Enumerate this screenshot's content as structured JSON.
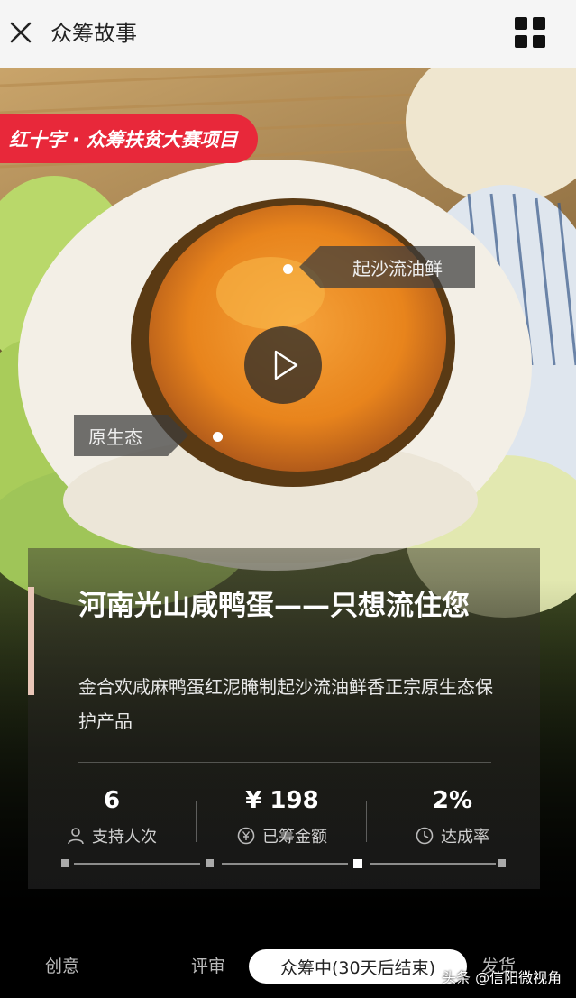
{
  "header": {
    "title": "众筹故事",
    "close_icon": "close-icon",
    "menu_icon": "grid-icon"
  },
  "hero": {
    "badge": "红十字 · 众筹扶贫大赛项目",
    "tag_right": "起沙流油鲜",
    "tag_left": "原生态",
    "play_icon": "play-icon"
  },
  "card": {
    "title": "河南光山咸鸭蛋——只想流住您",
    "description": "金合欢咸麻鸭蛋红泥腌制起沙流油鲜香正宗原生态保护产品",
    "stats": [
      {
        "value": "6",
        "label": "支持人次",
        "icon": "person-icon"
      },
      {
        "value": "¥ 198",
        "label": "已筹金额",
        "icon": "yen-coin-icon"
      },
      {
        "value": "2%",
        "label": "达成率",
        "icon": "clock-icon"
      }
    ]
  },
  "progress": {
    "stages": [
      {
        "label": "创意"
      },
      {
        "label": "评审"
      },
      {
        "label": "众筹中(30天后结束)"
      },
      {
        "label": "发货"
      }
    ]
  },
  "watermark": "头条 @信阳微视角",
  "colors": {
    "badge_red": "#e8283a",
    "accent_pink": "#e9c6b7",
    "header_bg": "#f5f5f5"
  }
}
